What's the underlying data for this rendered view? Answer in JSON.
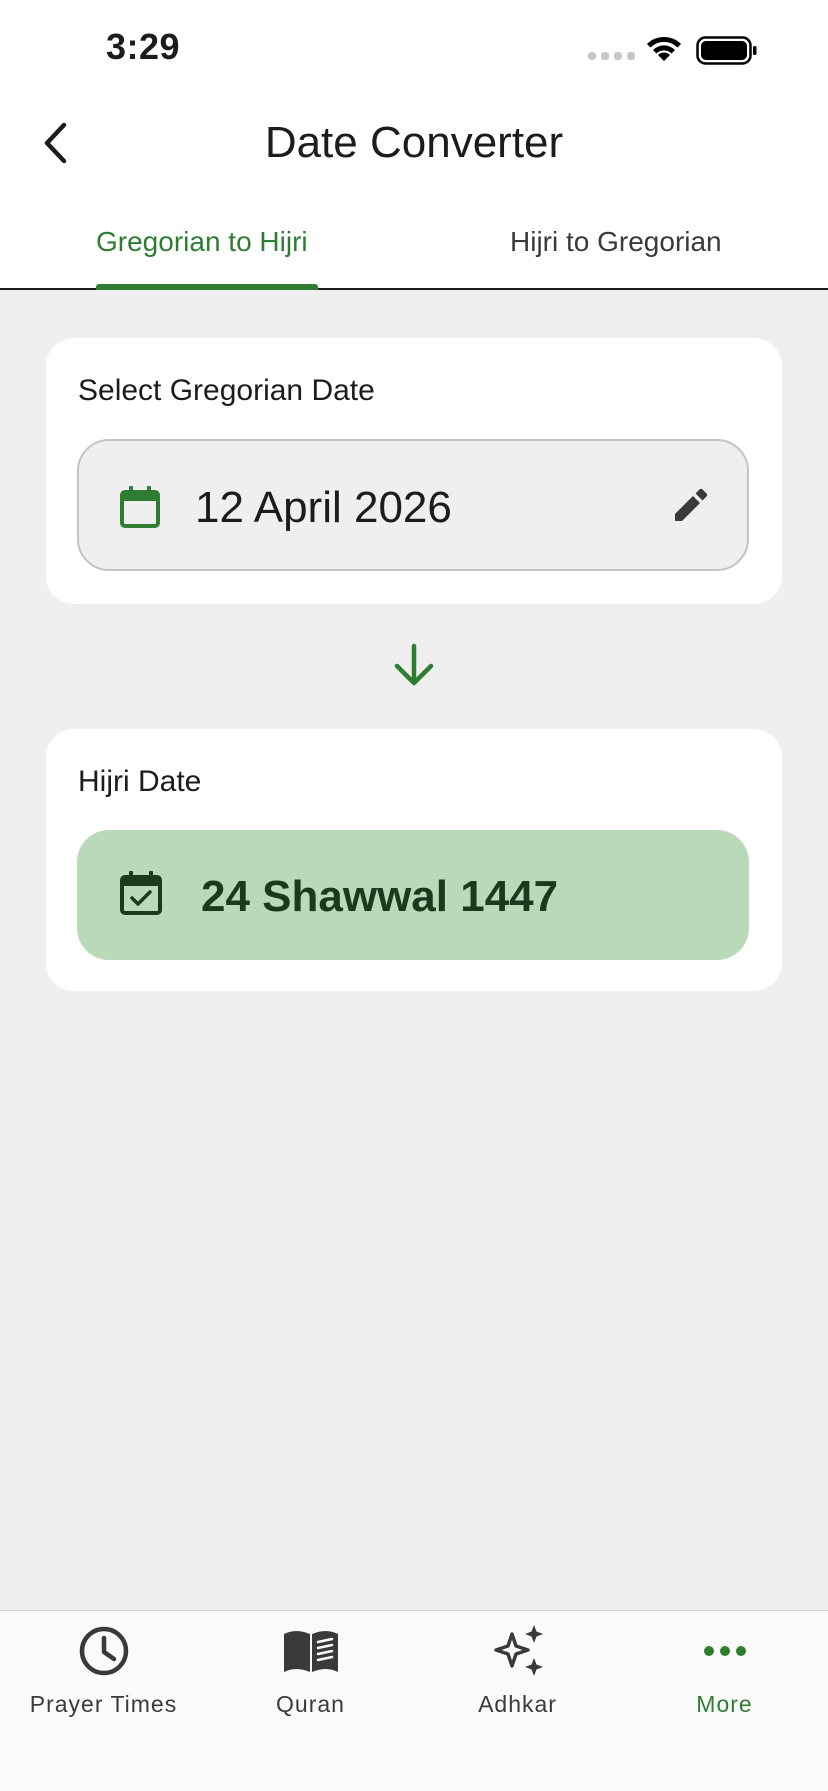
{
  "status_bar": {
    "time": "3:29"
  },
  "header": {
    "title": "Date Converter",
    "back_icon": "chevron-left-icon"
  },
  "tabs": [
    {
      "label": "Gregorian to Hijri",
      "active": true
    },
    {
      "label": "Hijri to Gregorian",
      "active": false
    }
  ],
  "gregorian_card": {
    "label": "Select Gregorian Date",
    "value": "12 April 2026",
    "leading_icon": "calendar-icon",
    "trailing_icon": "pencil-edit-icon"
  },
  "convert_arrow_icon": "arrow-down-icon",
  "hijri_card": {
    "label": "Hijri Date",
    "value": "24 Shawwal 1447",
    "leading_icon": "calendar-check-icon"
  },
  "bottom_nav": {
    "items": [
      {
        "label": "Prayer Times",
        "icon": "clock-icon",
        "active": false
      },
      {
        "label": "Quran",
        "icon": "book-icon",
        "active": false
      },
      {
        "label": "Adhkar",
        "icon": "sparkles-icon",
        "active": false
      },
      {
        "label": "More",
        "icon": "more-dots-icon",
        "active": true
      }
    ]
  },
  "colors": {
    "accent": "#2e7d32",
    "result_background": "#b9d9b8",
    "page_background": "#efefef",
    "card_background": "#ffffff"
  }
}
